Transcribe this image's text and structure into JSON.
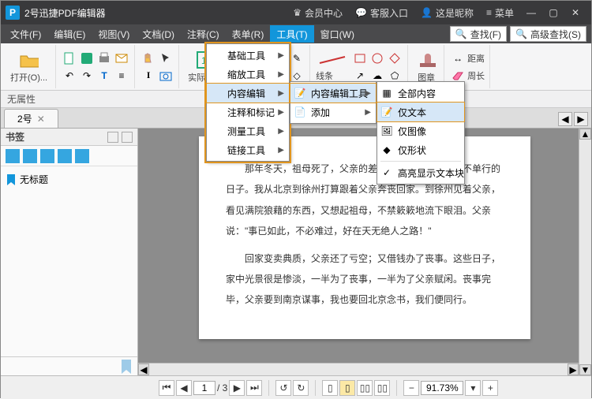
{
  "titlebar": {
    "app_title": "2号迅捷PDF编辑器",
    "member": "会员中心",
    "support": "客服入口",
    "nickname": "这是昵称",
    "menu": "菜单"
  },
  "menubar": {
    "items": [
      "文件(F)",
      "编辑(E)",
      "视图(V)",
      "文档(D)",
      "注释(C)",
      "表单(R)",
      "工具(T)",
      "窗口(W)"
    ],
    "active": 6,
    "search": "查找(F)",
    "adv_search": "高级查找(S)"
  },
  "ribbon": {
    "open": "打开(O)...",
    "size_label": "实际大小",
    "shapes": "线条",
    "stamp": "图章",
    "distance": "距离",
    "perimeter": "周长"
  },
  "sub": {
    "label": "无属性"
  },
  "tabs": {
    "items": [
      "2号"
    ]
  },
  "sidebar": {
    "title": "书签",
    "bookmark_item": "无标题"
  },
  "tool_menu": {
    "items": [
      "基础工具",
      "缩放工具",
      "内容编辑",
      "注释和标记",
      "测量工具",
      "链接工具"
    ],
    "highlighted": 2
  },
  "content_menu": {
    "items": [
      "内容编辑工具",
      "添加"
    ],
    "highlighted": 0
  },
  "target_menu": {
    "items": [
      "全部内容",
      "仅文本",
      "仅图像",
      "仅形状"
    ],
    "highlighted": 1,
    "last": "高亮显示文本块",
    "checked": 4
  },
  "doc": {
    "p1": "那年冬天，祖母死了，父亲的差使也交卸了，正是祸不单行的日子。我从北京到徐州打算跟着父亲奔丧回家。到徐州见着父亲，看见满院狼藉的东西，又想起祖母，不禁簌簌地流下眼泪。父亲说：\"事已如此，不必难过，好在天无绝人之路！\"",
    "p2": "回家变卖典质，父亲还了亏空；又借钱办了丧事。这些日子，家中光景很是惨淡，一半为了丧事，一半为了父亲赋闲。丧事完毕，父亲要到南京谋事，我也要回北京念书，我们便同行。"
  },
  "status": {
    "page_input": "1",
    "page_total": "/ 3",
    "zoom": "91.73%"
  }
}
